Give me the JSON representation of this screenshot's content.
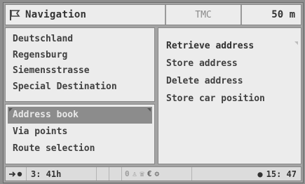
{
  "header": {
    "title": "Navigation",
    "center_label": "TMC",
    "scale": "50 m",
    "icon": "navigation-flag-icon"
  },
  "destination": {
    "lines": [
      "Deutschland",
      "Regensburg",
      "Siemensstrasse",
      "Special Destination"
    ]
  },
  "left_menu": {
    "items": [
      {
        "label": "Address book",
        "selected": true
      },
      {
        "label": "Via points",
        "selected": false
      },
      {
        "label": "Route selection",
        "selected": false
      }
    ]
  },
  "right_menu": {
    "items": [
      {
        "label": "Retrieve address",
        "active": true
      },
      {
        "label": "Store address"
      },
      {
        "label": "Delete address"
      },
      {
        "label": "Store car position"
      }
    ]
  },
  "status_bar": {
    "route_icon": "route-arrow-icon",
    "remaining_time": "3: 41h",
    "indicator_zero": "0",
    "icons": [
      "traffic-icon",
      "phone-icon",
      "euro-icon",
      "service-icon"
    ],
    "clock": "15: 47"
  },
  "colors": {
    "background": "#a3a3a3",
    "panel": "#ececec",
    "selected": "#8c8c8c"
  }
}
